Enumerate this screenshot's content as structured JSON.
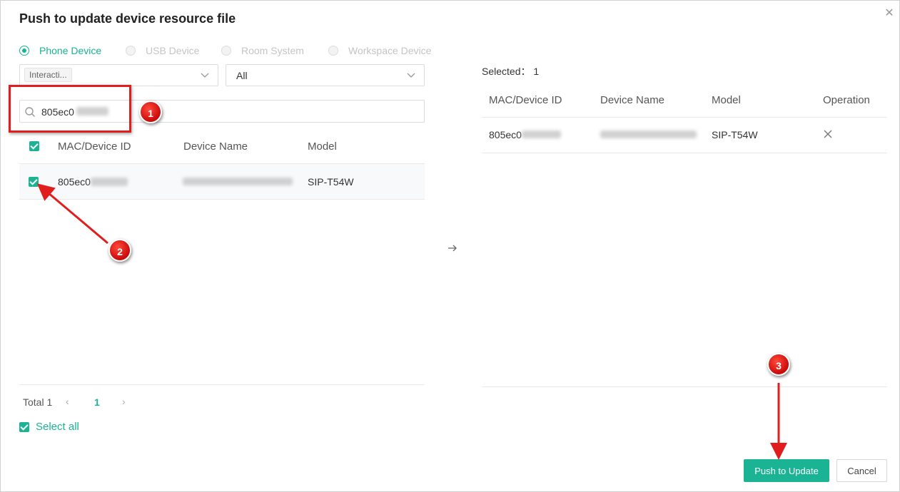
{
  "dialog": {
    "title": "Push to update device resource file",
    "close_icon": "close-icon"
  },
  "device_types": [
    {
      "label": "Phone Device",
      "selected": true
    },
    {
      "label": "USB Device",
      "selected": false
    },
    {
      "label": "Room System",
      "selected": false
    },
    {
      "label": "Workspace Device",
      "selected": false
    }
  ],
  "filters": {
    "group_tag": "Interacti...",
    "model_value": "All"
  },
  "search": {
    "value": "805ec0"
  },
  "left_table": {
    "headers": [
      "MAC/Device ID",
      "Device Name",
      "Model"
    ],
    "rows": [
      {
        "mac": "805ec0",
        "model": "SIP-T54W",
        "checked": true
      }
    ]
  },
  "pagination": {
    "total_label": "Total 1",
    "current_page": "1"
  },
  "select_all_label": "Select all",
  "right_panel": {
    "selected_label": "Selected： 1",
    "headers": [
      "MAC/Device ID",
      "Device Name",
      "Model",
      "Operation"
    ],
    "rows": [
      {
        "mac": "805ec0",
        "model": "SIP-T54W"
      }
    ]
  },
  "buttons": {
    "push_to_update": "Push to Update",
    "cancel": "Cancel"
  },
  "annotations": {
    "step1": "1",
    "step2": "2",
    "step3": "3",
    "color": "#e01e1e"
  },
  "colors": {
    "accent": "#1ab394"
  }
}
